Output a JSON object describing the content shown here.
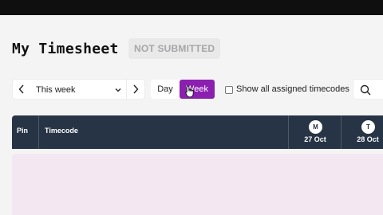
{
  "page": {
    "title": "My Timesheet",
    "status": "NOT SUBMITTED"
  },
  "toolbar": {
    "period_value": "This week",
    "view_toggle": {
      "day_label": "Day",
      "week_label": "Week",
      "selected": "Week"
    },
    "show_all_label": "Show all assigned timecodes",
    "show_all_checked": false
  },
  "table": {
    "columns": {
      "pin": "Pin",
      "timecode": "Timecode"
    },
    "days": [
      {
        "initial": "M",
        "date": "27 Oct"
      },
      {
        "initial": "T",
        "date": "28 Oct"
      }
    ]
  },
  "colors": {
    "accent": "#8a1fb0",
    "header_bg": "#263445",
    "body_highlight": "#f3e8f2"
  },
  "icons": [
    "chevron-left-icon",
    "chevron-right-icon",
    "chevron-down-icon",
    "search-icon",
    "cursor-icon"
  ]
}
